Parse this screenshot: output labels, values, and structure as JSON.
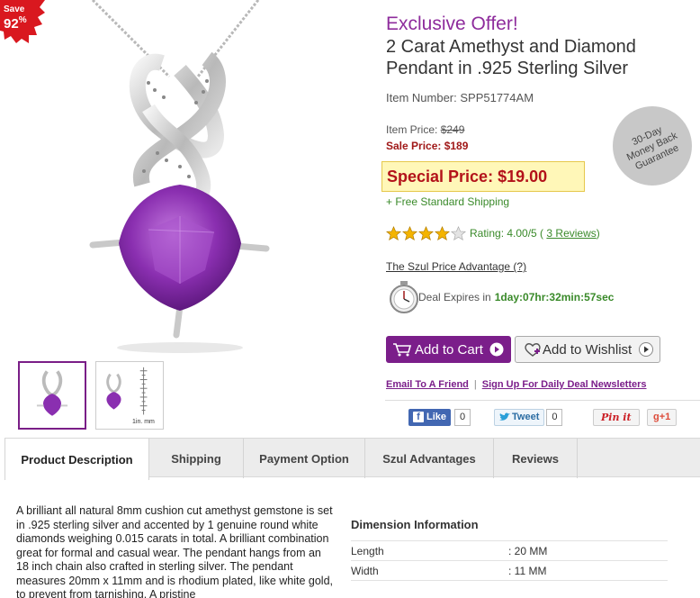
{
  "badge": {
    "line1": "Save",
    "line2": "92",
    "percent": "%",
    "color": "#d9181f"
  },
  "product": {
    "offer": "Exclusive Offer!",
    "title": "2 Carat Amethyst and Diamond Pendant in .925 Sterling Silver",
    "item_number": "Item Number: SPP51774AM",
    "item_price_label": "Item Price:",
    "item_price": "$249",
    "sale_price": "Sale Price: $189",
    "special_price": "Special Price: $19.00",
    "shipping": "+ Free Standard Shipping"
  },
  "guarantee": {
    "line1": "30-Day",
    "line2": "Money Back",
    "line3": "Guarantee"
  },
  "rating": {
    "value": 4.0,
    "max": 5,
    "text": "Rating: 4.00/5 (",
    "reviews_link": "3 Reviews",
    "close": ")"
  },
  "szul_advantage_link": "The Szul Price Advantage (?)",
  "deal": {
    "label": "Deal Expires in",
    "time": "1day:07hr:32min:57sec"
  },
  "buttons": {
    "add_to_cart": "Add to Cart",
    "add_to_wishlist": "Add to Wishlist"
  },
  "links": {
    "email": "Email To A Friend",
    "separator": "|",
    "newsletter": "Sign Up For Daily Deal Newsletters"
  },
  "social": {
    "like": "Like",
    "like_count": "0",
    "tweet": "Tweet",
    "tweet_count": "0",
    "pin": "Pin it",
    "gplus": "g+1"
  },
  "thumb_scale_label": "1in. mm",
  "tabs": [
    {
      "label": "Product Description",
      "active": true
    },
    {
      "label": "Shipping"
    },
    {
      "label": "Payment Option"
    },
    {
      "label": "Szul Advantages"
    },
    {
      "label": "Reviews"
    }
  ],
  "description": "A brilliant all natural 8mm cushion cut amethyst gemstone is set in .925 sterling silver and accented by 1 genuine round white diamonds weighing 0.015 carats in total. A brilliant combination great for formal and casual wear. The pendant hangs from an 18 inch chain also crafted in sterling silver. The pendant measures 20mm x 11mm and is rhodium plated, like white gold, to prevent from tarnishing. A pristine",
  "dimensions": {
    "title": "Dimension Information",
    "rows": [
      {
        "key": "Length",
        "value": ": 20 MM"
      },
      {
        "key": "Width",
        "value": ": 11 MM"
      }
    ]
  },
  "colors": {
    "accent": "#7b1e8a",
    "offer": "#8e2c9c",
    "sale": "#a01818",
    "green": "#3a8a2a",
    "amethyst": "#8a2fb0"
  }
}
